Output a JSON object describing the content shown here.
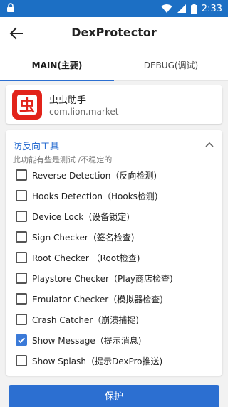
{
  "status_bar": {
    "time": "2:33",
    "icons": [
      "lock-icon",
      "wifi-icon",
      "signal-icon",
      "battery-icon"
    ]
  },
  "app_bar": {
    "title": "DexProtector",
    "back_icon": "arrow-left-icon"
  },
  "tabs": [
    {
      "label": "MAIN(主要)",
      "active": true
    },
    {
      "label": "DEBUG(调试)",
      "active": false
    }
  ],
  "target_app": {
    "name": "虫虫助手",
    "package": "com.lion.market",
    "logo_text": "虫"
  },
  "features": {
    "title": "防反向工具",
    "subtitle": "此功能有些是测试 /不稳定的",
    "options": [
      {
        "label": "Reverse Detection（反向检测)",
        "checked": false
      },
      {
        "label": "Hooks Detection（Hooks检测)",
        "checked": false
      },
      {
        "label": "Device Lock（设备锁定)",
        "checked": false
      },
      {
        "label": "Sign Checker（签名检查)",
        "checked": false
      },
      {
        "label": "Root Checker （Root检查)",
        "checked": false
      },
      {
        "label": "Playstore Checker（Play商店检查)",
        "checked": false
      },
      {
        "label": "Emulator Checker（模拟器检查)",
        "checked": false
      },
      {
        "label": "Crash Catcher（崩溃捕捉)",
        "checked": false
      },
      {
        "label": "Show Message（提示消息)",
        "checked": true
      },
      {
        "label": "Show Splash（提示DexPro推送)",
        "checked": false
      }
    ]
  },
  "protect_button": {
    "label": "保护"
  },
  "colors": {
    "status_bar": "#1c6fc4",
    "accent": "#2c6fd1",
    "logo_red": "#e2231a"
  }
}
